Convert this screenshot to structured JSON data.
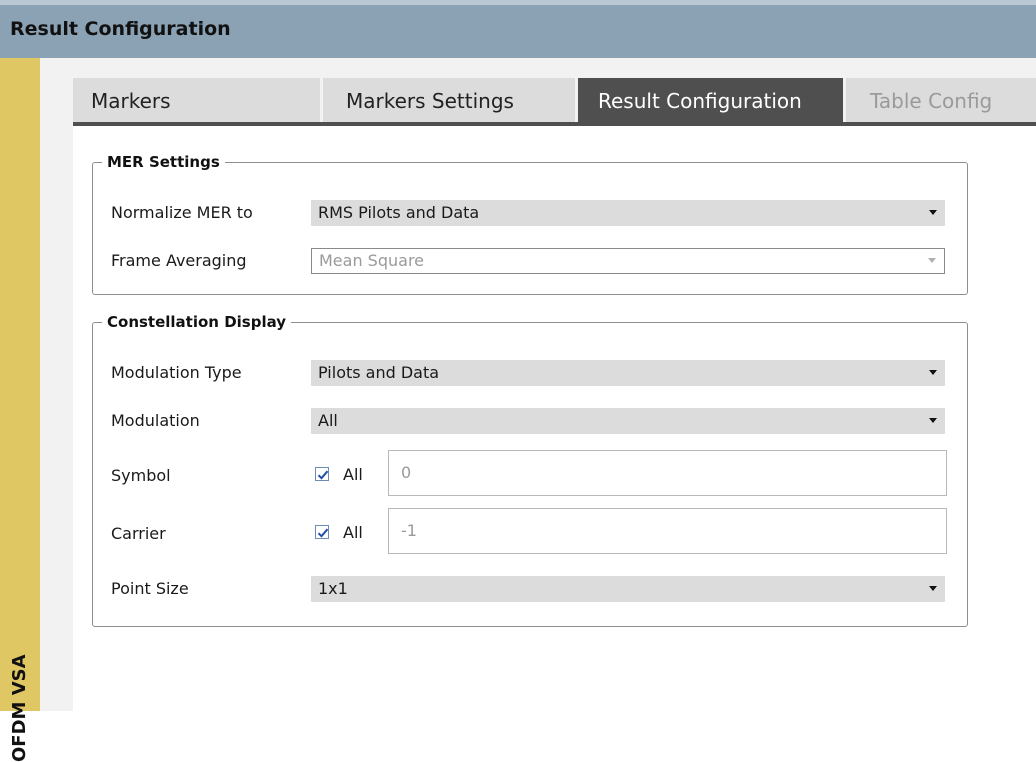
{
  "window": {
    "title": "Result Configuration"
  },
  "sidebar": {
    "label": "OFDM VSA"
  },
  "tabs": [
    {
      "label": "Markers",
      "state": "normal"
    },
    {
      "label": "Markers Settings",
      "state": "normal"
    },
    {
      "label": "Result Configuration",
      "state": "active"
    },
    {
      "label": "Table Config",
      "state": "disabled"
    }
  ],
  "mer_settings": {
    "legend": "MER Settings",
    "normalize": {
      "label": "Normalize MER to",
      "value": "RMS Pilots and Data"
    },
    "frame_averaging": {
      "label": "Frame Averaging",
      "value": "Mean Square",
      "enabled": false
    }
  },
  "constellation": {
    "legend": "Constellation Display",
    "modulation_type": {
      "label": "Modulation Type",
      "value": "Pilots and Data"
    },
    "modulation": {
      "label": "Modulation",
      "value": "All"
    },
    "symbol": {
      "label": "Symbol",
      "all_checked": true,
      "all_label": "All",
      "value": "0"
    },
    "carrier": {
      "label": "Carrier",
      "all_checked": true,
      "all_label": "All",
      "value": "-1"
    },
    "point_size": {
      "label": "Point Size",
      "value": "1x1"
    }
  },
  "colors": {
    "titlebar": "#8aa2b4",
    "sidebar": "#dfc863",
    "active_tab": "#4f4f4f",
    "dropdown": "#dcdcdc"
  }
}
